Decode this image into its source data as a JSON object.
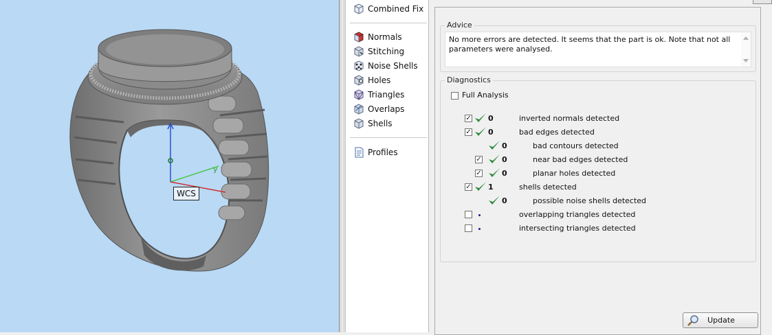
{
  "viewport": {
    "wcs_label": "WCS"
  },
  "toollist": {
    "top_item": {
      "label": "Combined Fix",
      "icon": "cube-icon"
    },
    "items": [
      {
        "label": "Normals",
        "icon": "normals-cube-icon"
      },
      {
        "label": "Stitching",
        "icon": "stitching-cube-icon"
      },
      {
        "label": "Noise Shells",
        "icon": "noise-shells-icon"
      },
      {
        "label": "Holes",
        "icon": "holes-cube-icon"
      },
      {
        "label": "Triangles",
        "icon": "triangles-cube-icon"
      },
      {
        "label": "Overlaps",
        "icon": "overlaps-cube-icon"
      },
      {
        "label": "Shells",
        "icon": "shells-cube-icon"
      }
    ],
    "profiles": {
      "label": "Profiles",
      "icon": "document-icon"
    }
  },
  "advice": {
    "title": "Advice",
    "text": "No more errors are detected. It seems that the part is ok. Note that not all parameters were analysed."
  },
  "diagnostics": {
    "title": "Diagnostics",
    "full_analysis": {
      "label": "Full Analysis",
      "checked": false
    },
    "rows": [
      {
        "checked": true,
        "status": "ok",
        "count": "0",
        "label": "inverted normals detected"
      },
      {
        "checked": true,
        "status": "ok",
        "count": "0",
        "label": "bad edges detected"
      },
      {
        "checked": null,
        "status": "ok",
        "count": "0",
        "label": "bad contours detected"
      },
      {
        "checked": true,
        "status": "ok",
        "count": "0",
        "label": "near bad edges detected"
      },
      {
        "checked": true,
        "status": "ok",
        "count": "0",
        "label": "planar holes detected"
      },
      {
        "checked": true,
        "status": "ok",
        "count": "1",
        "label": "shells detected"
      },
      {
        "checked": null,
        "status": "ok",
        "count": "0",
        "label": "possible noise shells detected"
      },
      {
        "checked": false,
        "status": "pending",
        "count": "",
        "label": "overlapping triangles detected"
      },
      {
        "checked": false,
        "status": "pending",
        "count": "",
        "label": "intersecting triangles detected"
      }
    ],
    "update_button": {
      "label": "Update",
      "icon": "magnifier-icon"
    }
  },
  "colors": {
    "viewport_bg": "#b9d9f5",
    "check_green": "#2e8b3c",
    "ring_gray": "#8e8e8e"
  }
}
